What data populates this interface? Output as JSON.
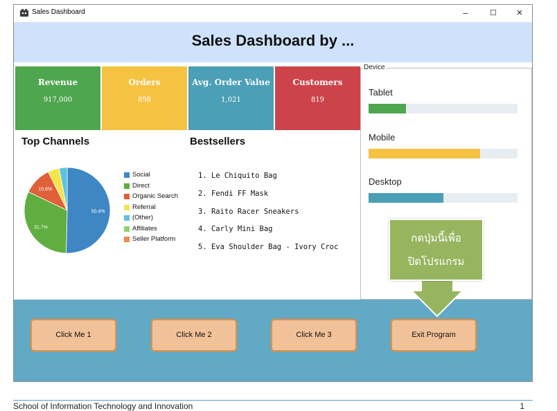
{
  "window": {
    "title": "Sales Dashboard",
    "minimize": "–",
    "maximize": "☐",
    "close": "✕"
  },
  "header": {
    "title": "Sales Dashboard by ..."
  },
  "cards": [
    {
      "label": "Revenue",
      "value": "917,000",
      "color": "#4ea64e"
    },
    {
      "label": "Orders",
      "value": "898",
      "color": "#f5c242"
    },
    {
      "label": "Avg. Order Value",
      "value": "1,021",
      "color": "#4b9fb6"
    },
    {
      "label": "Customers",
      "value": "819",
      "color": "#cc4449"
    }
  ],
  "top_channels": {
    "title": "Top Channels",
    "legend": [
      {
        "name": "Social",
        "color": "#3e87c4"
      },
      {
        "name": "Direct",
        "color": "#5fae3f"
      },
      {
        "name": "Organic Search",
        "color": "#e0603a"
      },
      {
        "name": "Referral",
        "color": "#f4e54a"
      },
      {
        "name": "(Other)",
        "color": "#5bc3e0"
      },
      {
        "name": "Affiliates",
        "color": "#8fd36a"
      },
      {
        "name": "Seller Platform",
        "color": "#f08b4a"
      }
    ],
    "slice_labels": [
      "50.4%",
      "31.7%",
      "10.6%"
    ]
  },
  "chart_data": {
    "type": "pie",
    "categories": [
      "Social",
      "Direct",
      "Organic Search",
      "Referral",
      "(Other)",
      "Affiliates",
      "Seller Platform"
    ],
    "values": [
      50.4,
      31.7,
      10.6,
      4.3,
      3.0,
      0,
      0
    ],
    "colors": [
      "#3e87c4",
      "#5fae3f",
      "#e0603a",
      "#f4e54a",
      "#5bc3e0",
      "#8fd36a",
      "#f08b4a"
    ],
    "title": "Top Channels"
  },
  "bestsellers": {
    "title": "Bestsellers",
    "items": [
      "1. Le Chiquito Bag",
      "2. Fendi FF Mask",
      "3. Raito Racer Sneakers",
      "4. Carly Mini Bag",
      "5. Eva Shoulder Bag - Ivory Croc"
    ]
  },
  "device": {
    "legend": "Device",
    "items": [
      {
        "label": "Tablet",
        "fraction": 0.25,
        "color": "#4ea64e"
      },
      {
        "label": "Mobile",
        "fraction": 0.75,
        "color": "#f5c242"
      },
      {
        "label": "Desktop",
        "fraction": 0.5,
        "color": "#4b9fb6"
      }
    ]
  },
  "callout": {
    "line1": "กดปุ่มนี้เพื่อ",
    "line2": "ปิดโปรแกรม"
  },
  "buttons": {
    "b1": "Click Me 1",
    "b2": "Click Me 2",
    "b3": "Click Me 3",
    "exit": "Exit Program"
  },
  "page_footer": {
    "school": "School of Information Technology and Innovation",
    "page": "1"
  }
}
